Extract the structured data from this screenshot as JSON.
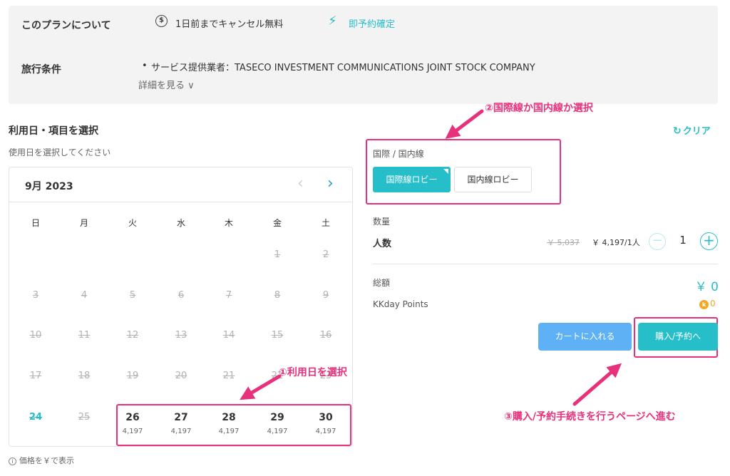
{
  "plan": {
    "about_label": "このプランについて",
    "cancel_text": "1日前までキャンセル無料",
    "instant_text": "即予約確定",
    "conditions_label": "旅行条件",
    "provider_text": "サービス提供業者：TASECO INVESTMENT COMMUNICATIONS JOINT STOCK COMPANY",
    "details_link": "詳細を見る ∨"
  },
  "selection": {
    "title": "利用日・項目を選択",
    "subtitle": "使用日を選択してください",
    "clear_label": "クリア"
  },
  "calendar": {
    "month_label": "9月 2023",
    "weekdays": [
      "日",
      "月",
      "火",
      "水",
      "木",
      "金",
      "土"
    ],
    "weeks": [
      [
        null,
        null,
        null,
        null,
        null,
        "1",
        "2"
      ],
      [
        "3",
        "4",
        "5",
        "6",
        "7",
        "8",
        "9"
      ],
      [
        "10",
        "11",
        "12",
        "13",
        "14",
        "15",
        "16"
      ],
      [
        "17",
        "18",
        "19",
        "20",
        "21",
        "22",
        "23"
      ],
      [
        "24",
        "25",
        "26",
        "27",
        "28",
        "29",
        "30"
      ]
    ],
    "today": "24",
    "available": [
      {
        "day": "26",
        "price": "4,197"
      },
      {
        "day": "27",
        "price": "4,197"
      },
      {
        "day": "28",
        "price": "4,197"
      },
      {
        "day": "29",
        "price": "4,197"
      },
      {
        "day": "30",
        "price": "4,197"
      }
    ],
    "price_note": "価格を￥で表示"
  },
  "options": {
    "label": "国際 / 国内線",
    "international": "国際線ロビー",
    "domestic": "国内線ロビー"
  },
  "quantity": {
    "label": "数量",
    "name": "人数",
    "old_price": "￥ 5,037",
    "price": "￥ 4,197/1人",
    "minus": "−",
    "value": "1",
    "plus": "+"
  },
  "totals": {
    "total_label": "総額",
    "total_value": "￥ 0",
    "points_label": "KKday Points",
    "points_coin": "k",
    "points_value": "0"
  },
  "actions": {
    "cart": "カートに入れる",
    "book": "購入/予約へ"
  },
  "annotations": {
    "step1": "①利用日を選択",
    "step2": "②国際線か国内線か選択",
    "step3": "③購入/予約手続きを行うページへ進む"
  },
  "colors": {
    "accent": "#26bec9",
    "highlight": "#e8317b",
    "cart": "#5eb1f4",
    "points": "#f5a623"
  }
}
